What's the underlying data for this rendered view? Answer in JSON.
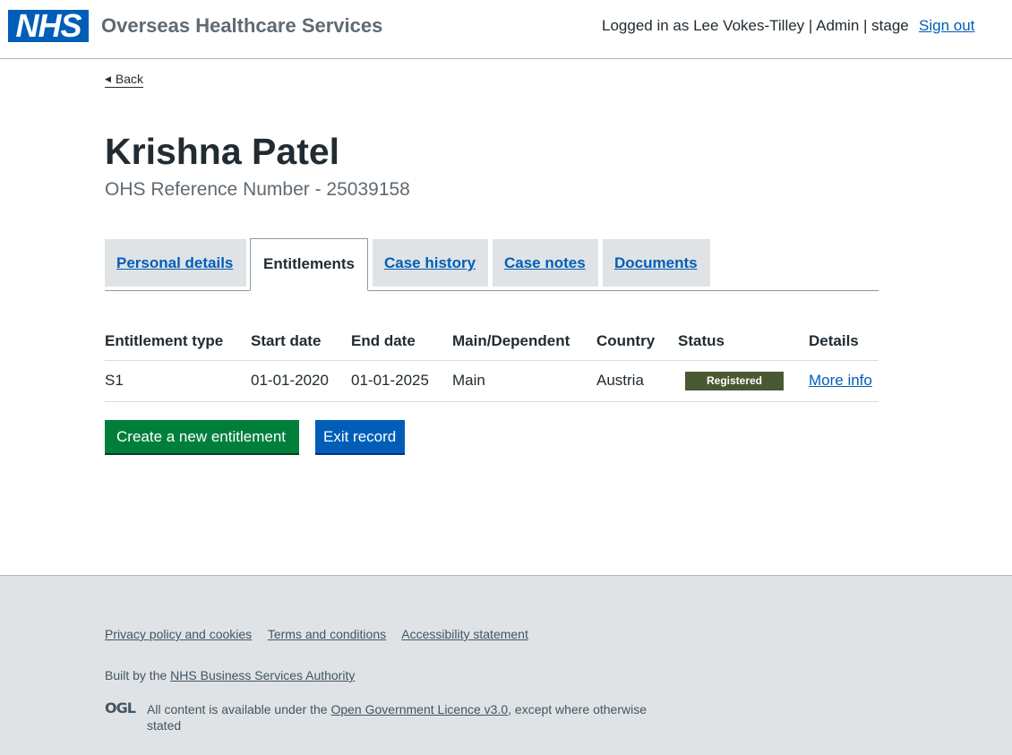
{
  "header": {
    "logo": "NHS",
    "service_name": "Overseas Healthcare Services",
    "user_info": "Logged in as Lee Vokes-Tilley | Admin | stage",
    "sign_out": "Sign out"
  },
  "back_link": "Back",
  "patient": {
    "name": "Krishna Patel",
    "reference": "OHS Reference Number - 25039158"
  },
  "tabs": [
    {
      "label": "Personal details",
      "active": false
    },
    {
      "label": "Entitlements",
      "active": true
    },
    {
      "label": "Case history",
      "active": false
    },
    {
      "label": "Case notes",
      "active": false
    },
    {
      "label": "Documents",
      "active": false
    }
  ],
  "table": {
    "headers": [
      "Entitlement type",
      "Start date",
      "End date",
      "Main/Dependent",
      "Country",
      "Status",
      "Details"
    ],
    "rows": [
      {
        "type": "S1",
        "start": "01-01-2020",
        "end": "01-01-2025",
        "main_dependent": "Main",
        "country": "Austria",
        "status": "Registered",
        "details": "More info"
      }
    ]
  },
  "buttons": {
    "create": "Create a new entitlement",
    "exit": "Exit record"
  },
  "footer": {
    "links": [
      "Privacy policy and cookies",
      "Terms and conditions",
      "Accessibility statement"
    ],
    "built_by_prefix": "Built by the ",
    "built_by_link": "NHS Business Services Authority",
    "ogl_logo": "OGL",
    "licence_prefix": "All content is available under the ",
    "licence_link": "Open Government Licence v3.0",
    "licence_suffix": ", except where otherwise stated"
  },
  "colors": {
    "nhs_blue": "#005eb8",
    "green_button": "#007f3b",
    "status_badge": "#4a5932",
    "footer_bg": "#e0e3e5"
  }
}
